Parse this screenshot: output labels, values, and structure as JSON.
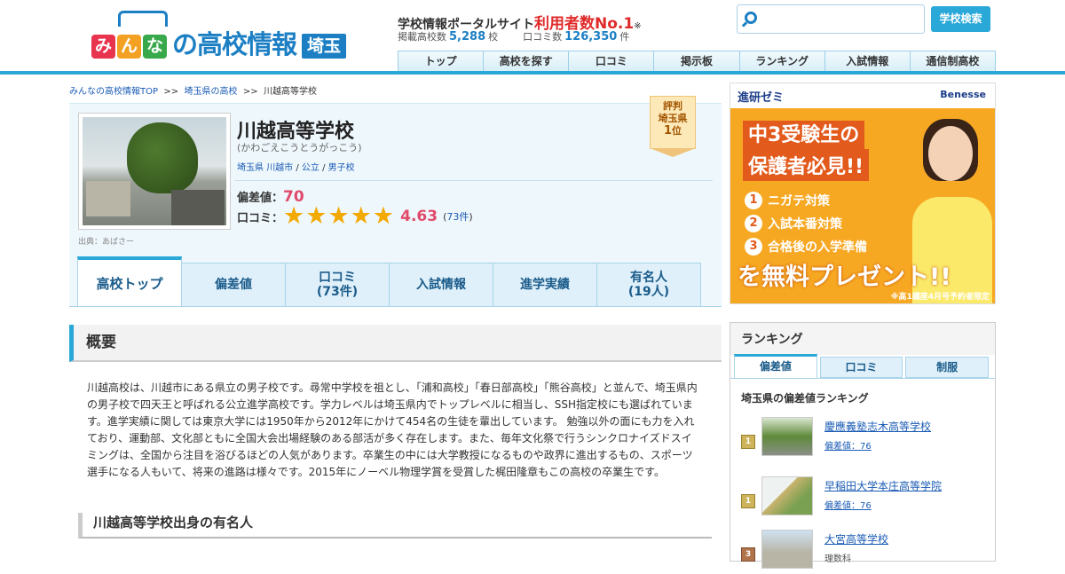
{
  "header": {
    "logo_chars": [
      "み",
      "ん",
      "な"
    ],
    "logo_rest": "の高校情報",
    "logo_pref": "埼玉",
    "tagline_pre": "学校情報ポータルサイト",
    "tagline_red": "利用者数No.1",
    "tagline_mark": "※",
    "stat_schools_label": "掲載高校数",
    "stat_schools_value": "5,288",
    "stat_schools_unit": "校",
    "stat_reviews_label": "口コミ数",
    "stat_reviews_value": "126,350",
    "stat_reviews_unit": "件",
    "search_placeholder": "",
    "search_button": "学校検索",
    "nav": [
      "トップ",
      "高校を探す",
      "口コミ",
      "掲示板",
      "ランキング",
      "入試情報",
      "通信制高校"
    ],
    "colors": {
      "accent": "#2aa8d8",
      "brand": "#1c7fc4",
      "logo_chars": [
        "#e8344e",
        "#f2a122",
        "#37a94a"
      ]
    }
  },
  "breadcrumb": {
    "items": [
      "みんなの高校情報TOP",
      "埼玉県の高校",
      "川越高等学校"
    ],
    "sep": ">>"
  },
  "school": {
    "name": "川越高等学校",
    "kana": "(かわごえこうとうがっこう)",
    "tags": [
      "埼玉県",
      "川越市",
      "公立",
      "男子校"
    ],
    "photo_source_label": "出典：",
    "photo_source_link": "あばさー",
    "hensachi_label": "偏差値：",
    "hensachi_value": "70",
    "review_label": "口コミ：",
    "review_stars": 5,
    "review_score": "4.63",
    "review_count": "73件",
    "badge_line1": "評判",
    "badge_line2": "埼玉県",
    "badge_line3": "1",
    "badge_line3_unit": "位"
  },
  "tabs": [
    {
      "label": "高校トップ",
      "sub": ""
    },
    {
      "label": "偏差値",
      "sub": ""
    },
    {
      "label": "口コミ",
      "sub": "(73件)"
    },
    {
      "label": "入試情報",
      "sub": ""
    },
    {
      "label": "進学実績",
      "sub": ""
    },
    {
      "label": "有名人",
      "sub": "(19人)"
    }
  ],
  "overview": {
    "heading": "概要",
    "text": "川越高校は、川越市にある県立の男子校です。尋常中学校を祖とし、「浦和高校」「春日部高校」「熊谷高校」と並んで、埼玉県内の男子校で四天王と呼ばれる公立進学高校です。学力レベルは埼玉県内でトップレベルに相当し、SSH指定校にも選ばれています。進学実績に関しては東京大学には1950年から2012年にかけて454名の生徒を輩出しています。 勉強以外の面にも力を入れており、運動部、文化部ともに全国大会出場経験のある部活が多く存在します。また、毎年文化祭で行うシンクロナイズドスイミングは、全国から注目を浴びるほどの人気があります。卒業生の中には大学教授になるものや政界に進出するもの、スポーツ選手になる人もいて、将来の進路は様々です。2015年にノーベル物理学賞を受賞した梶田隆章もこの高校の卒業生です。",
    "famous_heading": "川越高等学校出身の有名人"
  },
  "ad": {
    "brand": "進研ゼミ",
    "partner": "Benesse",
    "head1": "中3受験生の",
    "head2": "保護者必見!!",
    "items": [
      {
        "n": "1",
        "text": "ニガテ対策"
      },
      {
        "n": "2",
        "text": "入試本番対策"
      },
      {
        "n": "3",
        "text": "合格後の入学準備"
      }
    ],
    "cta": "を無料プレゼント!!",
    "note": "※高1講座4月号予約者限定"
  },
  "ranking": {
    "title": "ランキング",
    "tabs": [
      "偏差値",
      "口コミ",
      "制服"
    ],
    "subtitle": "埼玉県の偏差値ランキング",
    "items": [
      {
        "rank": "1",
        "name": "慶應義塾志木高等学校",
        "value": "偏差値：76"
      },
      {
        "rank": "1",
        "name": "早稲田大学本庄高等学院",
        "value": "偏差値：76"
      },
      {
        "rank": "3",
        "name": "大宮高等学校",
        "value": "理数科"
      }
    ]
  }
}
